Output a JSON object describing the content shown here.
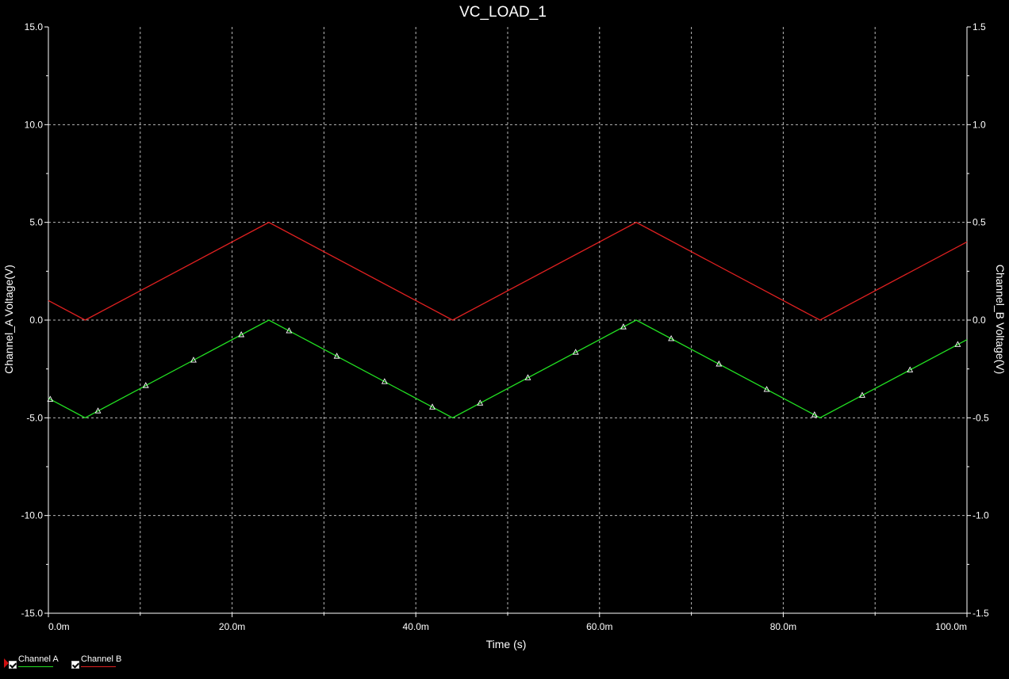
{
  "chart_data": {
    "type": "line",
    "title": "VC_LOAD_1",
    "xlabel": "Time (s)",
    "ylabel_left": "Channel_A Voltage(V)",
    "ylabel_right": "Channel_B Voltage(V)",
    "xlim": [
      0,
      0.1
    ],
    "ylim_left": [
      -15,
      15
    ],
    "ylim_right": [
      -1.5,
      1.5
    ],
    "grid": true,
    "legend_position": "bottom-left",
    "x_ticks": [
      {
        "value": 0,
        "label": "0.0m"
      },
      {
        "value": 0.02,
        "label": "20.0m"
      },
      {
        "value": 0.04,
        "label": "40.0m"
      },
      {
        "value": 0.06,
        "label": "60.0m"
      },
      {
        "value": 0.08,
        "label": "80.0m"
      },
      {
        "value": 0.1,
        "label": "100.0m"
      }
    ],
    "y_ticks_left": [
      {
        "value": 15,
        "label": "15.0"
      },
      {
        "value": 10,
        "label": "10.0"
      },
      {
        "value": 5,
        "label": "5.0"
      },
      {
        "value": 0,
        "label": "0.0"
      },
      {
        "value": -5,
        "label": "-5.0"
      },
      {
        "value": -10,
        "label": "-10.0"
      },
      {
        "value": -15,
        "label": "-15.0"
      }
    ],
    "y_ticks_right": [
      {
        "value": 1.5,
        "label": "1.5"
      },
      {
        "value": 1.0,
        "label": "1.0"
      },
      {
        "value": 0.5,
        "label": "0.5"
      },
      {
        "value": 0.0,
        "label": "0.0"
      },
      {
        "value": -0.5,
        "label": "-0.5"
      },
      {
        "value": -1.0,
        "label": "-1.0"
      },
      {
        "value": -1.5,
        "label": "-1.5"
      }
    ],
    "series": [
      {
        "name": "Channel A",
        "color": "#22e022",
        "axis": "left",
        "marker": "triangle",
        "x": [
          0,
          0.004,
          0.024,
          0.044,
          0.064,
          0.084,
          0.1
        ],
        "y": [
          -4.0,
          -5.0,
          0.0,
          -5.0,
          0.0,
          -5.0,
          -1.0
        ]
      },
      {
        "name": "Channel B",
        "color": "#e02020",
        "axis": "left",
        "x": [
          0,
          0.004,
          0.024,
          0.044,
          0.064,
          0.084,
          0.1
        ],
        "y": [
          1.0,
          0.0,
          5.0,
          0.0,
          5.0,
          0.0,
          4.0
        ]
      }
    ]
  },
  "legend": {
    "items": [
      {
        "label": "Channel A",
        "color": "#22e022"
      },
      {
        "label": "Channel B",
        "color": "#e02020"
      }
    ]
  }
}
